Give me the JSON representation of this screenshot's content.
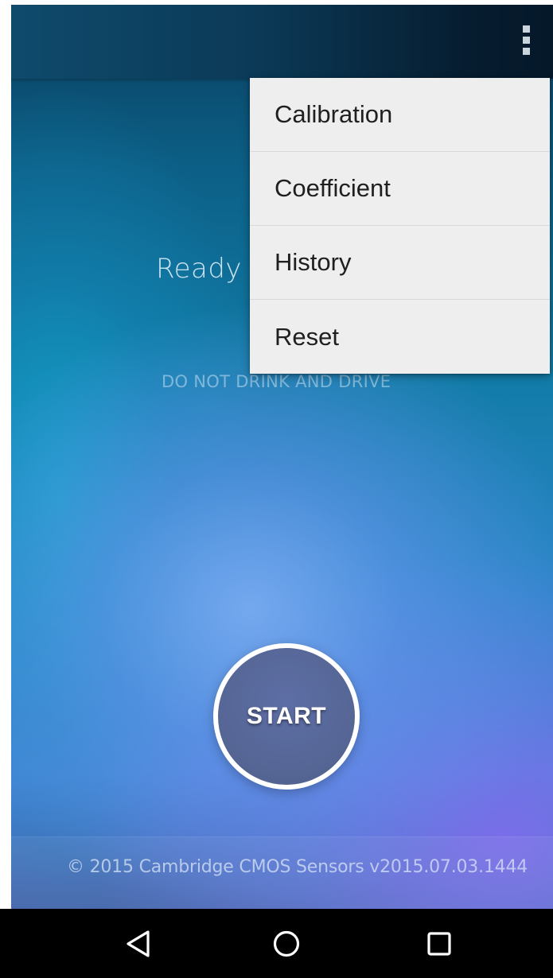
{
  "main": {
    "status_text": "Ready",
    "warning_text": "DO NOT DRINK AND DRIVE",
    "start_label": "START"
  },
  "footer": {
    "copyright": "© 2015 Cambridge CMOS Sensors v2015.07.03.1444"
  },
  "overflow_menu": {
    "items": [
      {
        "label": "Calibration"
      },
      {
        "label": "Coefficient"
      },
      {
        "label": "History"
      },
      {
        "label": "Reset"
      }
    ]
  },
  "navigation_bar": {
    "back_icon": "back-triangle-icon",
    "home_icon": "home-circle-icon",
    "recents_icon": "recents-square-icon"
  },
  "colors": {
    "appbar": "#0b3a57",
    "menu_background": "#eeeeee",
    "start_button": "#556593",
    "nav_background": "#000000"
  }
}
